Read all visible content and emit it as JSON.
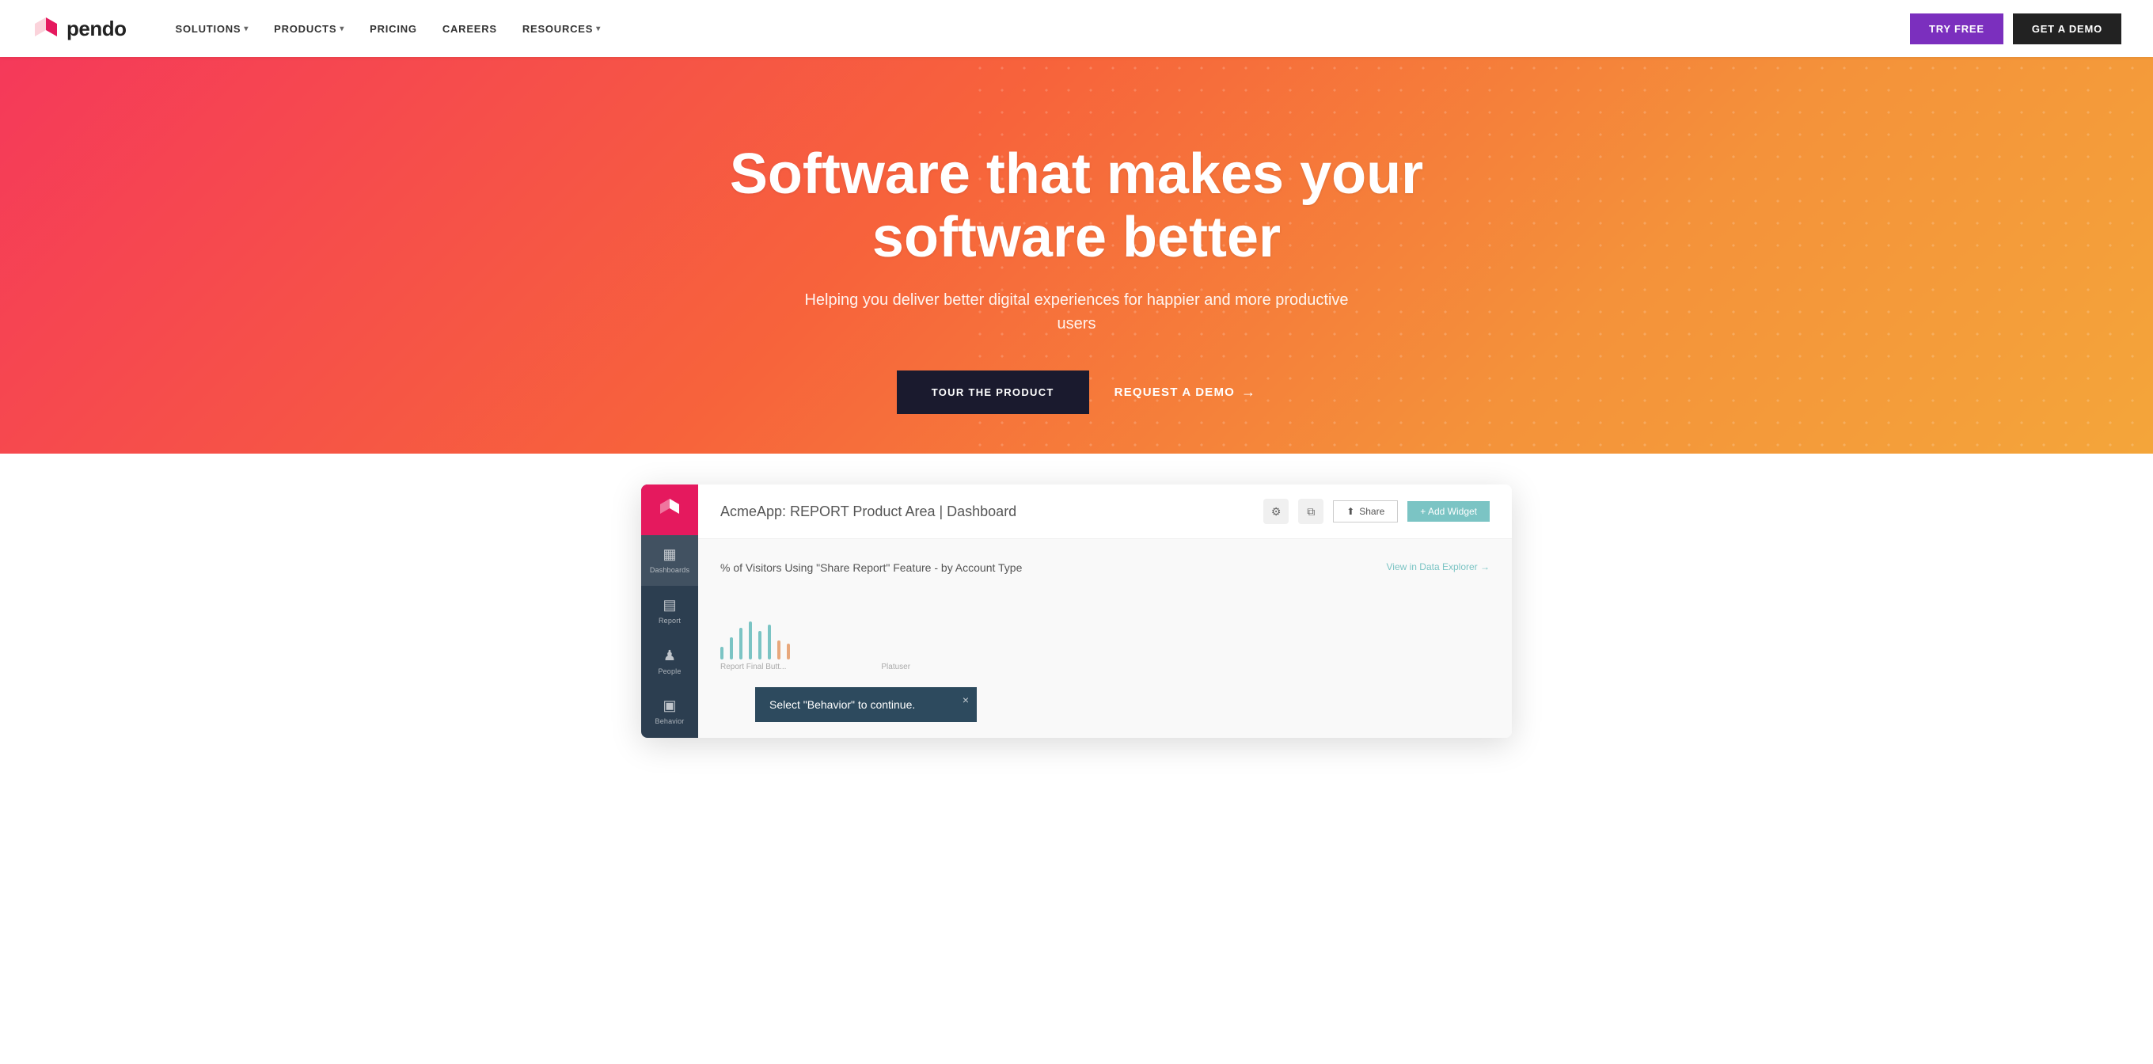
{
  "nav": {
    "logo_text": "pendo",
    "links": [
      {
        "label": "SOLUTIONS",
        "has_dropdown": true
      },
      {
        "label": "PRODUCTS",
        "has_dropdown": true
      },
      {
        "label": "PRICING",
        "has_dropdown": false
      },
      {
        "label": "CAREERS",
        "has_dropdown": false
      },
      {
        "label": "RESOURCES",
        "has_dropdown": true
      }
    ],
    "try_free": "TRY FREE",
    "get_demo": "GET A DEMO"
  },
  "hero": {
    "title": "Software that makes your software better",
    "subtitle": "Helping you deliver better digital experiences for happier and more productive users",
    "tour_btn": "TOUR THE PRODUCT",
    "demo_link": "REQUEST A DEMO",
    "arrow": "→"
  },
  "dashboard": {
    "title": "AcmeApp: REPORT Product Area | Dashboard",
    "widget_title": "% of Visitors Using \"Share Report\" Feature - by Account Type",
    "view_data_explorer": "View in Data Explorer →",
    "share_btn": "Share",
    "add_widget_btn": "+ Add Widget",
    "chart_labels": [
      "Report Final Butt...",
      "Platuser"
    ],
    "tooltip": {
      "close": "×",
      "text": "Select \"Behavior\" to continue."
    },
    "sidebar_items": [
      {
        "label": "Dashboards",
        "icon": "▦"
      },
      {
        "label": "Report",
        "icon": "▤"
      },
      {
        "label": "People",
        "icon": "👥"
      },
      {
        "label": "Behavior",
        "icon": "▣"
      }
    ]
  },
  "icons": {
    "settings": "⚙",
    "copy": "⧉",
    "share_upload": "⬆",
    "close": "×",
    "chevron_down": "▾"
  }
}
